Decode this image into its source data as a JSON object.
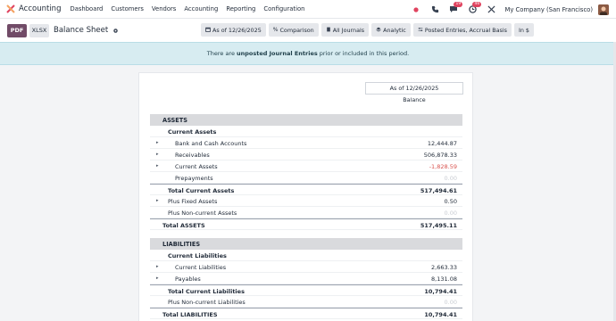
{
  "navbar": {
    "app_name": "Accounting",
    "menu": [
      "Dashboard",
      "Customers",
      "Vendors",
      "Accounting",
      "Reporting",
      "Configuration"
    ],
    "messages_badge": "19",
    "activities_badge": "46",
    "company": "My Company (San Francisco)"
  },
  "control": {
    "pdf_label": "PDF",
    "xlsx_label": "XLSX",
    "title": "Balance Sheet",
    "filters": [
      {
        "icon": "calendar-icon",
        "label": "As of 12/26/2025"
      },
      {
        "icon": "percent-icon",
        "label": "Comparison"
      },
      {
        "icon": "book-icon",
        "label": "All Journals"
      },
      {
        "icon": "layers-icon",
        "label": "Analytic"
      },
      {
        "icon": "sliders-icon",
        "label": "Posted Entries, Accrual Basis"
      },
      {
        "icon": "currency-icon",
        "label": "In $"
      }
    ]
  },
  "notice": {
    "prefix": "There are",
    "link": "unposted Journal Entries",
    "suffix": "prior or included in this period."
  },
  "report": {
    "column_header": "As of 12/26/2025",
    "column_sub": "Balance",
    "assets_header": "ASSETS",
    "liabilities_header": "LIABILITIES",
    "rows": [
      {
        "label": "Current Assets",
        "value": "",
        "level": 1,
        "bold": true,
        "caret": false
      },
      {
        "label": "Bank and Cash Accounts",
        "value": "12,444.87",
        "level": 2,
        "caret": true
      },
      {
        "label": "Receivables",
        "value": "506,878.33",
        "level": 2,
        "caret": true
      },
      {
        "label": "Current Assets",
        "value": "-1,828.59",
        "level": 2,
        "caret": true,
        "negative": true
      },
      {
        "label": "Prepayments",
        "value": "0.00",
        "level": 2,
        "caret": false,
        "muted": true
      },
      {
        "label": "Total Current Assets",
        "value": "517,494.61",
        "level": 1,
        "bold": true
      },
      {
        "label": "Plus Fixed Assets",
        "value": "0.50",
        "level": 1,
        "caret": true
      },
      {
        "label": "Plus Non-current Assets",
        "value": "0.00",
        "level": 1,
        "muted": true
      },
      {
        "label": "Total ASSETS",
        "value": "517,495.11",
        "level": 0,
        "bold": true
      },
      {
        "label": "Current Liabilities",
        "value": "",
        "level": 1,
        "bold": true
      },
      {
        "label": "Current Liabilities",
        "value": "2,663.33",
        "level": 2,
        "caret": true
      },
      {
        "label": "Payables",
        "value": "8,131.08",
        "level": 2,
        "caret": true
      },
      {
        "label": "Total Current Liabilities",
        "value": "10,794.41",
        "level": 1,
        "bold": true
      },
      {
        "label": "Plus Non-current Liabilities",
        "value": "0.00",
        "level": 1,
        "muted": true
      },
      {
        "label": "Total LIABILITIES",
        "value": "10,794.41",
        "level": 0,
        "bold": true
      }
    ]
  }
}
